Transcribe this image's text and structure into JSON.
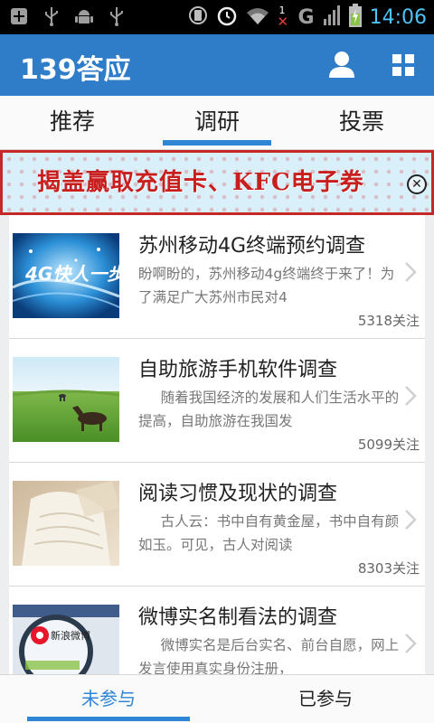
{
  "status_bar": {
    "time": "14:06",
    "network_label": "G",
    "sim_label": "1",
    "icons": [
      "add-notification-icon",
      "usb-icon",
      "android-icon",
      "usb-icon",
      "vibrate-icon",
      "alarm-icon",
      "wifi-icon",
      "signal-icon",
      "battery-charging-icon"
    ]
  },
  "app_bar": {
    "title": "139答应",
    "icons": [
      "user-icon",
      "grid-icon"
    ],
    "background": "#2f7cc9"
  },
  "tabs": [
    {
      "label": "推荐",
      "selected": false
    },
    {
      "label": "调研",
      "selected": true
    },
    {
      "label": "投票",
      "selected": false
    }
  ],
  "banner": {
    "text": "揭盖赢取充值卡、KFC电子券",
    "close_symbol": "✕"
  },
  "surveys": [
    {
      "title": "苏州移动4G终端预约调查",
      "description": "盼啊盼的，苏州移动4g终端终于来了！为了满足广大苏州市民对4",
      "followers": "5318关注",
      "thumb_text": "4G快人一步"
    },
    {
      "title": "自助旅游手机软件调查",
      "description": "     随着我国经济的发展和人们生活水平的提高，自助旅游在我国发",
      "followers": "5099关注",
      "thumb_text": ""
    },
    {
      "title": "阅读习惯及现状的调查",
      "description": "     古人云：书中自有黄金屋，书中自有颜如玉。可见，古人对阅读",
      "followers": "8303关注",
      "thumb_text": ""
    },
    {
      "title": "微博实名制看法的调查",
      "description": "     微博实名是后台实名、前台自愿，网上发言使用真实身份注册，",
      "followers": "",
      "thumb_text": "新浪微博"
    }
  ],
  "bottom_tabs": [
    {
      "label": "未参与",
      "selected": true
    },
    {
      "label": "已参与",
      "selected": false
    }
  ],
  "colors": {
    "accent": "#2f86d6",
    "banner_red": "#c81e1e",
    "time_blue": "#4fc3f7"
  }
}
